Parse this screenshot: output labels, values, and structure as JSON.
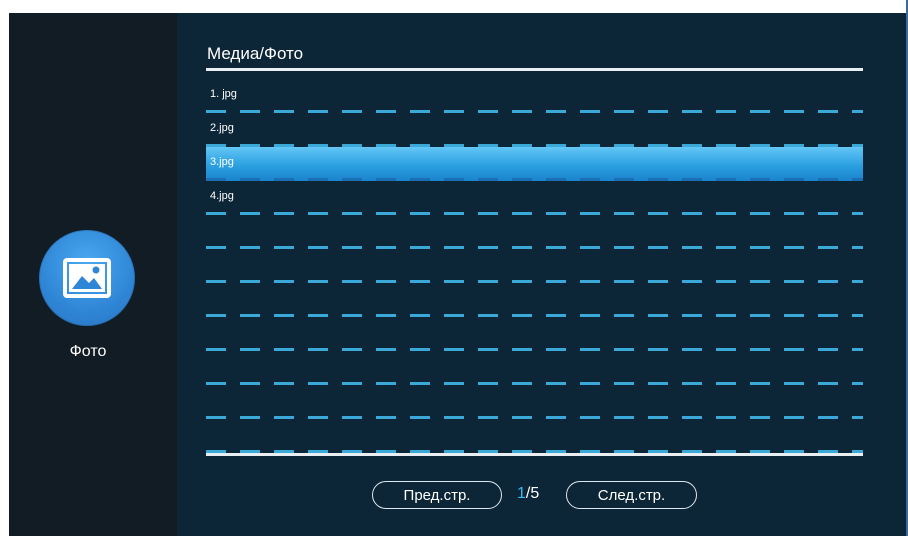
{
  "sidebar": {
    "icon": "image-icon",
    "label": "Фото"
  },
  "main": {
    "title": "Медиа/Фото",
    "files": [
      {
        "name": "1. jpg",
        "selected": false
      },
      {
        "name": "2.jpg",
        "selected": false
      },
      {
        "name": "3.jpg",
        "selected": true
      },
      {
        "name": "4.jpg",
        "selected": false
      },
      {
        "name": "",
        "selected": false
      },
      {
        "name": "",
        "selected": false
      },
      {
        "name": "",
        "selected": false
      },
      {
        "name": "",
        "selected": false
      },
      {
        "name": "",
        "selected": false
      },
      {
        "name": "",
        "selected": false
      },
      {
        "name": "",
        "selected": false
      }
    ]
  },
  "pager": {
    "prev_label": "Пред.стр.",
    "next_label": "След.стр.",
    "current": "1",
    "total": "/5"
  },
  "colors": {
    "background": "#0c2537",
    "sidebar": "#111c24",
    "accent": "#3fb7ef",
    "selection": "#2a9fe0"
  }
}
